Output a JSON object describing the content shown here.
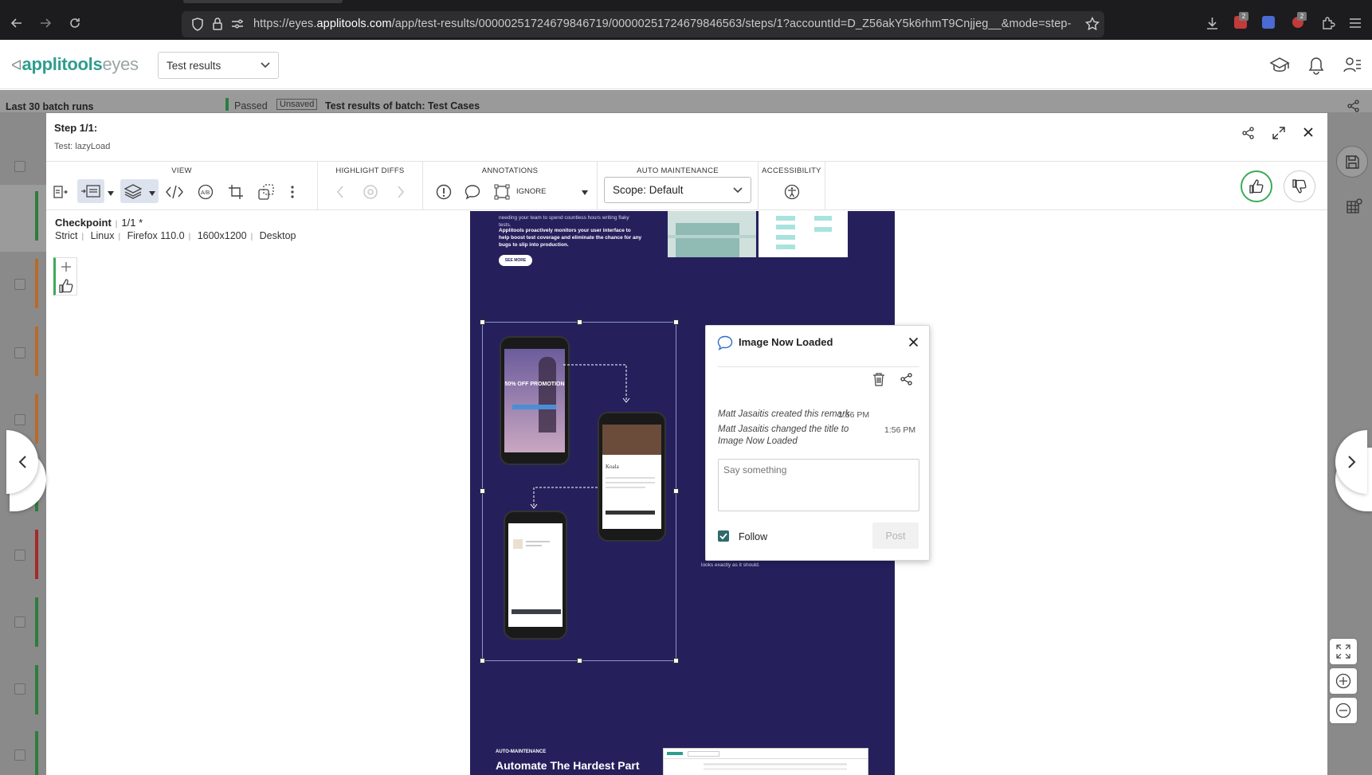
{
  "browser": {
    "url_prefix": "https://eyes.",
    "url_domain": "applitools.com",
    "url_rest": "/app/test-results/00000251724679846719/00000251724679846563/steps/1?accountId=D_Z56akY5k6rhmT9Cnjjeg__&mode=step-",
    "badges": [
      "2",
      "2"
    ]
  },
  "header": {
    "logo_main": "applitools",
    "logo_sub": "eyes",
    "dropdown_label": "Test results"
  },
  "background": {
    "left_title": "Last 30 batch runs",
    "status": "Passed",
    "unsaved": "Unsaved",
    "batch_title": "Test results of batch:  Test Cases"
  },
  "modal": {
    "step": "Step 1/1:",
    "test": "Test: lazyLoad",
    "toolbar": {
      "view_label": "VIEW",
      "highlight_label": "HIGHLIGHT DIFFS",
      "annotations_label": "ANNOTATIONS",
      "ignore_label": "IGNORE",
      "auto_label": "AUTO MAINTENANCE",
      "scope": "Scope: Default",
      "access_label": "ACCESSIBILITY"
    },
    "checkpoint": {
      "label": "Checkpoint",
      "count": "1/1",
      "asterisk": "*",
      "match": "Strict",
      "os": "Linux",
      "browser": "Firefox 110.0",
      "viewport": "1600x1200",
      "device": "Desktop"
    }
  },
  "screenshot": {
    "top_text1": "needing your team to spend countless hours writing flaky tests.",
    "top_text2": "Applitools proactively monitors your user interface to help boost test coverage and eliminate the chance for any bugs to slip into production.",
    "see_more": "SEE MORE",
    "promo": "50% OFF PROMOTION",
    "product": "Koala",
    "bottom_kicker": "AUTO-MAINTENANCE",
    "bottom_heading": "Automate The Hardest Part",
    "tail_text": "looks exactly as it should."
  },
  "remark": {
    "title": "Image Now Loaded",
    "history": [
      {
        "text": "Matt Jasaitis created this remark",
        "time": "1:56 PM"
      },
      {
        "text": "Matt Jasaitis changed the title to Image Now Loaded",
        "time": "1:56 PM"
      }
    ],
    "placeholder": "Say something",
    "follow_label": "Follow",
    "post_label": "Post"
  },
  "colors": {
    "brand": "#2e9d8f",
    "screenshot_bg": "#25205c",
    "pass": "#3caa5a"
  }
}
